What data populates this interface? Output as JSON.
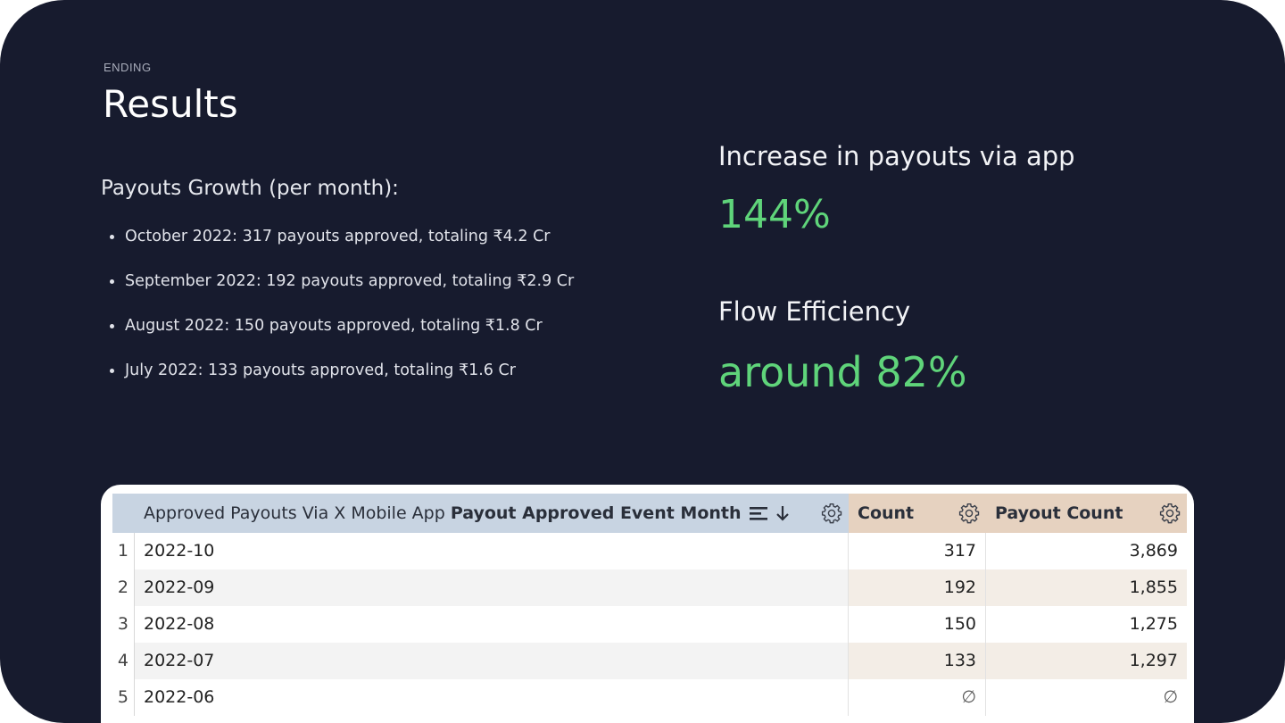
{
  "slide": {
    "eyebrow": "ENDING",
    "title": "Results",
    "growth_heading": "Payouts Growth (per month):",
    "bullets": [
      "October 2022: 317 payouts approved, totaling ₹4.2 Cr",
      "September 2022: 192 payouts approved, totaling ₹2.9 Cr",
      "August 2022: 150 payouts approved, totaling ₹1.8 Cr",
      "July 2022: 133 payouts approved, totaling ₹1.6 Cr"
    ],
    "stats": [
      {
        "label": "Increase in payouts via app",
        "value": "144%"
      },
      {
        "label": "Flow Efficiency",
        "value": "around 82%"
      }
    ]
  },
  "table": {
    "columns": {
      "month_prefix": "Approved Payouts Via X Mobile App",
      "month_bold": "Payout Approved Event Month",
      "count": "Count",
      "payout_count": "Payout Count"
    },
    "rows": [
      {
        "idx": "1",
        "month": "2022-10",
        "count": "317",
        "payout_count": "3,869"
      },
      {
        "idx": "2",
        "month": "2022-09",
        "count": "192",
        "payout_count": "1,855"
      },
      {
        "idx": "3",
        "month": "2022-08",
        "count": "150",
        "payout_count": "1,275"
      },
      {
        "idx": "4",
        "month": "2022-07",
        "count": "133",
        "payout_count": "1,297"
      },
      {
        "idx": "5",
        "month": "2022-06",
        "count": "∅",
        "payout_count": "∅"
      }
    ]
  },
  "colors": {
    "background": "#171b2e",
    "accent_green": "#5fd47a",
    "dimension_header": "#c8d4e2",
    "measure_header": "#e6d2c0"
  },
  "icons": [
    "gear-icon",
    "sort-lines-icon",
    "arrow-down-icon"
  ]
}
